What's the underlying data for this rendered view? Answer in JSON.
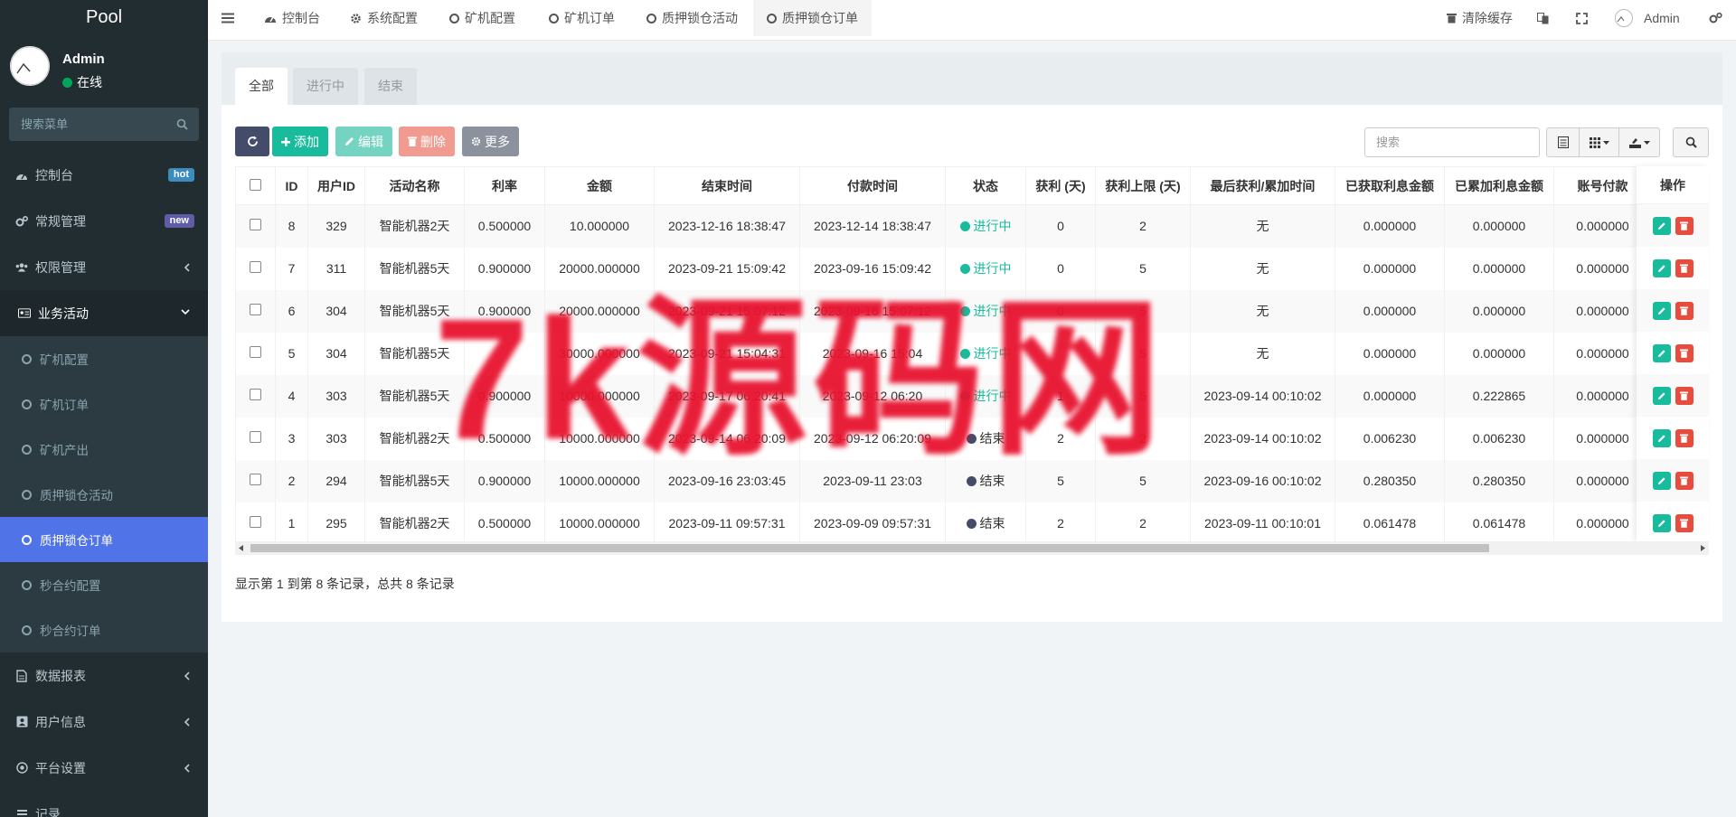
{
  "sidebar": {
    "brand": "Pool",
    "user": {
      "name": "Admin",
      "status": "在线"
    },
    "search_placeholder": "搜索菜单",
    "menu": [
      {
        "label": "控制台",
        "icon": "dashboard-icon",
        "badge": "hot",
        "badge_color": "#3c8dbc"
      },
      {
        "label": "常规管理",
        "icon": "cogs-icon",
        "badge": "new",
        "badge_color": "#605ca8"
      },
      {
        "label": "权限管理",
        "icon": "group-icon"
      },
      {
        "label": "业务活动",
        "icon": "id-card-icon"
      }
    ],
    "submenu": [
      "矿机配置",
      "矿机订单",
      "矿机产出",
      "质押锁仓活动",
      "质押锁仓订单",
      "秒合约配置",
      "秒合约订单"
    ],
    "menu_after": [
      {
        "label": "数据报表",
        "icon": "file-icon"
      },
      {
        "label": "用户信息",
        "icon": "user-card-icon"
      },
      {
        "label": "平台设置",
        "icon": "settings-icon"
      },
      {
        "label": "记录",
        "icon": "list-icon"
      }
    ]
  },
  "topbar": {
    "tabs": [
      "控制台",
      "系统配置",
      "矿机配置",
      "矿机订单",
      "质押锁仓活动",
      "质押锁仓订单"
    ],
    "clear_cache": "清除缓存",
    "admin": "Admin"
  },
  "content": {
    "filter_tabs": [
      "全部",
      "进行中",
      "结束"
    ],
    "toolbar": {
      "add": "添加",
      "edit": "编辑",
      "delete": "删除",
      "more": "更多"
    },
    "search_placeholder": "搜索",
    "columns": [
      "ID",
      "用户ID",
      "活动名称",
      "利率",
      "金额",
      "结束时间",
      "付款时间",
      "状态",
      "获利 (天)",
      "获利上限 (天)",
      "最后获利/累加时间",
      "已获取利息金额",
      "已累加利息金额",
      "账号付款"
    ],
    "op_header": "操作",
    "rows": [
      {
        "id": "8",
        "uid": "329",
        "name": "智能机器2天",
        "rate": "0.500000",
        "amount": "10.000000",
        "end": "2023-12-16 18:38:47",
        "pay": "2023-12-14 18:38:47",
        "status": "进行中",
        "status_type": "running",
        "days": "0",
        "limit": "2",
        "last": "无",
        "got": "0.000000",
        "acc": "0.000000",
        "acct": "0.000000"
      },
      {
        "id": "7",
        "uid": "311",
        "name": "智能机器5天",
        "rate": "0.900000",
        "amount": "20000.000000",
        "end": "2023-09-21 15:09:42",
        "pay": "2023-09-16 15:09:42",
        "status": "进行中",
        "status_type": "running",
        "days": "0",
        "limit": "5",
        "last": "无",
        "got": "0.000000",
        "acc": "0.000000",
        "acct": "0.000000"
      },
      {
        "id": "6",
        "uid": "304",
        "name": "智能机器5天",
        "rate": "0.900000",
        "amount": "20000.000000",
        "end": "2023-09-21 15:07:12",
        "pay": "2023-09-16 15:07:12",
        "status": "进行中",
        "status_type": "running",
        "days": "0",
        "limit": "5",
        "last": "无",
        "got": "0.000000",
        "acc": "0.000000",
        "acct": "0.000000"
      },
      {
        "id": "5",
        "uid": "304",
        "name": "智能机器5天",
        "rate": "",
        "amount": "30000.000000",
        "end": "2023-09-21 15:04:31",
        "pay": "2023-09-16 15:04",
        "status": "进行中",
        "status_type": "running",
        "days": "",
        "limit": "5",
        "last": "无",
        "got": "0.000000",
        "acc": "0.000000",
        "acct": "0.000000"
      },
      {
        "id": "4",
        "uid": "303",
        "name": "智能机器5天",
        "rate": "0.900000",
        "amount": "10000.000000",
        "end": "2023-09-17 06:20:41",
        "pay": "2023-09-12 06:20",
        "status": "进行中",
        "status_type": "running",
        "days": "1",
        "limit": "5",
        "last": "2023-09-14 00:10:02",
        "got": "0.000000",
        "acc": "0.222865",
        "acct": "0.000000"
      },
      {
        "id": "3",
        "uid": "303",
        "name": "智能机器2天",
        "rate": "0.500000",
        "amount": "10000.000000",
        "end": "2023-09-14 06:20:09",
        "pay": "2023-09-12 06:20:09",
        "status": "结束",
        "status_type": "ended",
        "days": "2",
        "limit": "2",
        "last": "2023-09-14 00:10:02",
        "got": "0.006230",
        "acc": "0.006230",
        "acct": "0.000000"
      },
      {
        "id": "2",
        "uid": "294",
        "name": "智能机器5天",
        "rate": "0.900000",
        "amount": "10000.000000",
        "end": "2023-09-16 23:03:45",
        "pay": "2023-09-11 23:03",
        "status": "结束",
        "status_type": "ended",
        "days": "5",
        "limit": "5",
        "last": "2023-09-16 00:10:02",
        "got": "0.280350",
        "acc": "0.280350",
        "acct": "0.000000"
      },
      {
        "id": "1",
        "uid": "295",
        "name": "智能机器2天",
        "rate": "0.500000",
        "amount": "10000.000000",
        "end": "2023-09-11 09:57:31",
        "pay": "2023-09-09 09:57:31",
        "status": "结束",
        "status_type": "ended",
        "days": "2",
        "limit": "2",
        "last": "2023-09-11 00:10:01",
        "got": "0.061478",
        "acc": "0.061478",
        "acct": "0.000000"
      }
    ],
    "pager_text": "显示第 1 到第 8 条记录，总共 8 条记录"
  },
  "watermark": "7k源码网",
  "colors": {
    "running": "#18bc9c",
    "ended": "#444c69",
    "accent": "#5073e8"
  }
}
